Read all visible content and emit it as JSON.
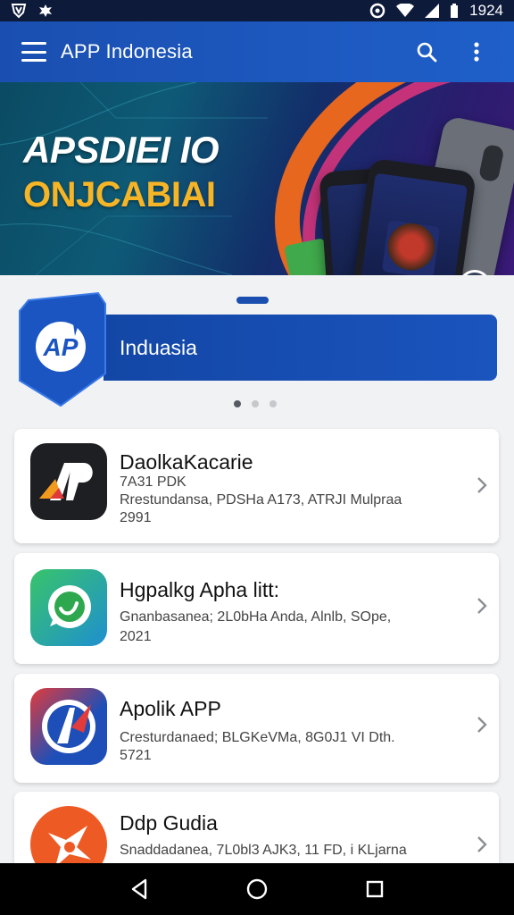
{
  "status_bar": {
    "time": "1924",
    "icons": [
      "shield-v-icon",
      "bug-icon",
      "alarm-icon",
      "wifi-icon",
      "signal-icon",
      "battery-icon"
    ]
  },
  "app_bar": {
    "title": "APP Indonesia",
    "actions": [
      "search-icon",
      "more-vert-icon"
    ],
    "color": "#1a4fb0"
  },
  "hero": {
    "line1": "APSDIEI IO",
    "line2": "ONJCABIAI",
    "line1_color": "#ffffff",
    "line2_color": "#f6b526"
  },
  "ribbon": {
    "logo_text": "AP",
    "label": "Induasia",
    "page_dots": 3,
    "active_dot": 0
  },
  "apps": [
    {
      "name": "DaolkaKacarie",
      "line1": "7A31 PDK",
      "line2": "Rrestundansa, PDSHa A173, ATRJI Mulpraa",
      "line3": "2991",
      "icon": "ap-logo-icon"
    },
    {
      "name": "Hgpalkg Apha litt:",
      "line1": "Gnanbasanea; 2L0bHa Anda, Alnlb, SOpe,",
      "line2": "2021",
      "line3": "",
      "icon": "chat-bubble-icon"
    },
    {
      "name": "Apolik APP",
      "line1": "Cresturdanaed; BLGKeVMa, 8G0J1 VI Dth.",
      "line2": "5721",
      "line3": "",
      "icon": "compass-a-icon"
    },
    {
      "name": "Ddp Gudia",
      "line1": "Snaddadanea, 7L0bl3 AJK3, 11 FD, i KLjarna",
      "line2": "",
      "line3": "",
      "icon": "star-burst-icon"
    }
  ],
  "nav": [
    "back-icon",
    "home-icon",
    "recents-icon"
  ]
}
